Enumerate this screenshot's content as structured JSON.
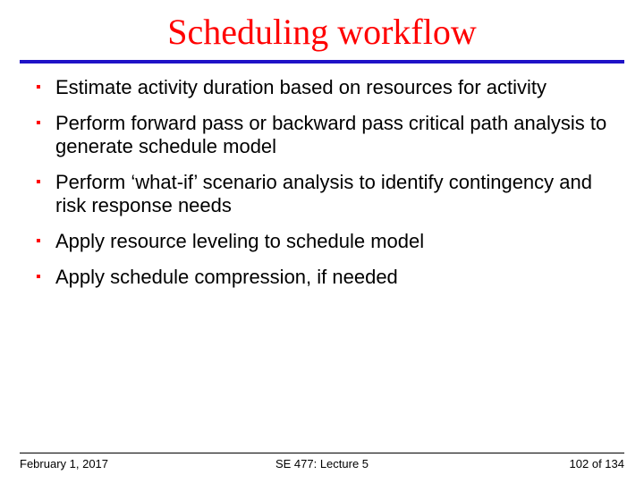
{
  "title": "Scheduling workflow",
  "bullets": [
    "Estimate activity duration based on resources for activity",
    "Perform forward pass or backward pass critical path analysis to generate schedule model",
    "Perform ‘what-if’ scenario analysis to identify contingency and risk response needs",
    "Apply resource leveling to schedule model",
    "Apply schedule compression, if needed"
  ],
  "footer": {
    "date": "February 1, 2017",
    "course": "SE 477: Lecture 5",
    "page": "102 of 134"
  }
}
